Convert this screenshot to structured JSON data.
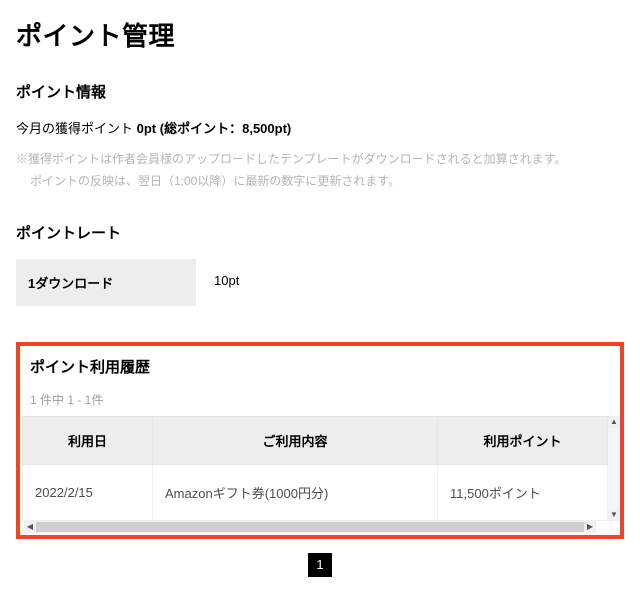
{
  "page_title": "ポイント管理",
  "info_section": {
    "heading": "ポイント情報",
    "current_label": "今月の獲得ポイント",
    "current_value": "0pt",
    "total_prefix": "(総ポイント：",
    "total_value": "8,500pt",
    "total_suffix": ")",
    "note1": "※獲得ポイントは作者会員様のアップロードしたテンプレートがダウンロードされると加算されます。",
    "note2": "ポイントの反映は、翌日（1:00以降）に最新の数字に更新されます。"
  },
  "rate_section": {
    "heading": "ポイントレート",
    "label": "1ダウンロード",
    "value": "10pt"
  },
  "history_section": {
    "heading": "ポイント利用履歴",
    "pager_text": "1 件中 1 - 1件",
    "columns": {
      "date": "利用日",
      "content": "ご利用内容",
      "points": "利用ポイント"
    },
    "rows": [
      {
        "date": "2022/2/15",
        "content": "Amazonギフト券(1000円分)",
        "points": "11,500ポイント"
      }
    ]
  },
  "pagination": {
    "current": "1"
  }
}
